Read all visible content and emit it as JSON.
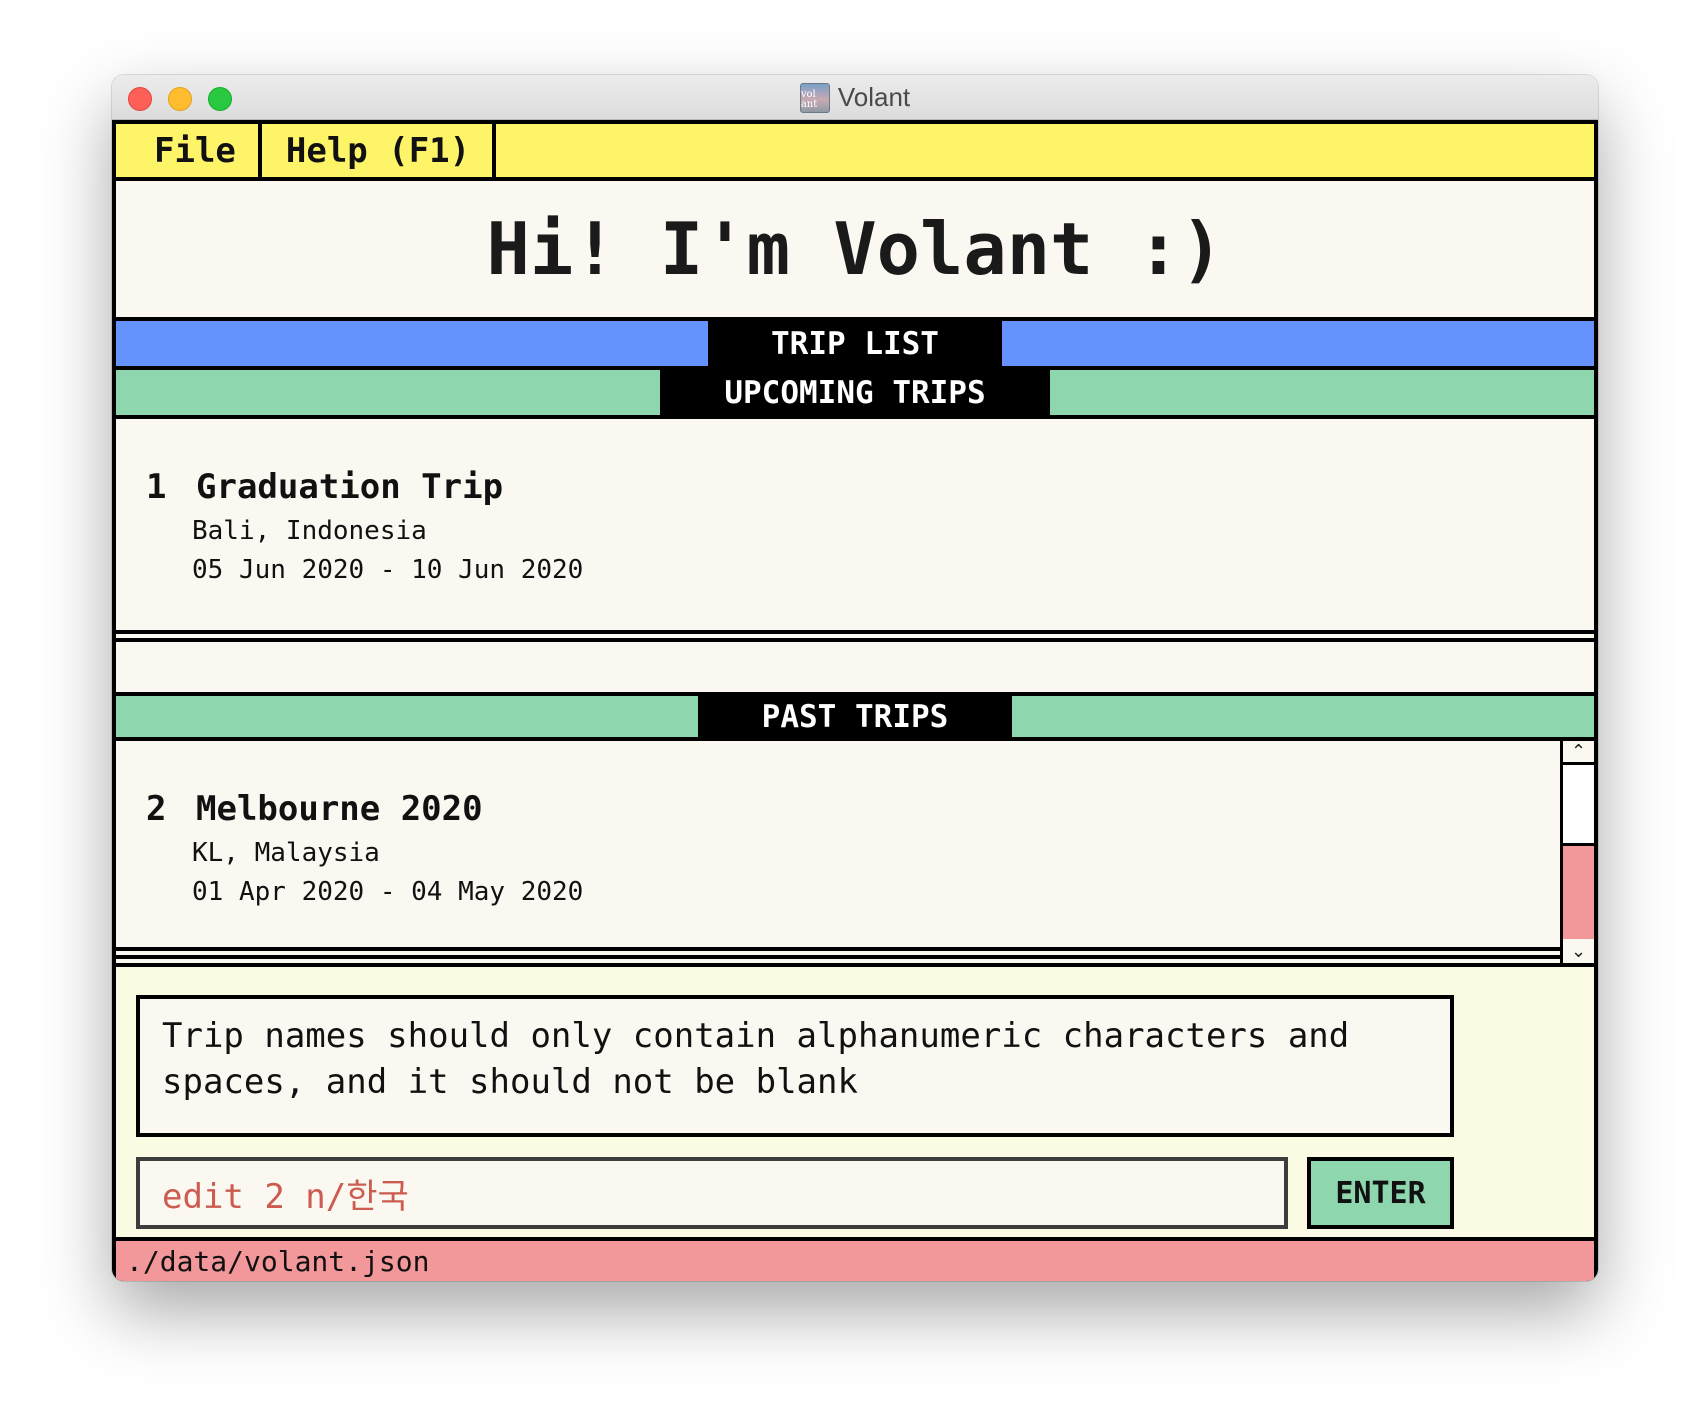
{
  "window": {
    "title": "Volant",
    "app_icon_text": "vol ant"
  },
  "menu": {
    "file_label": "File",
    "help_label": "Help (F1)"
  },
  "greeting": "Hi! I'm Volant :)",
  "sections": {
    "trip_list_label": "TRIP LIST",
    "upcoming_label": "UPCOMING TRIPS",
    "past_label": "PAST TRIPS"
  },
  "upcoming_trips": [
    {
      "index": "1",
      "name": "Graduation Trip",
      "location": "Bali, Indonesia",
      "dates": "05 Jun 2020 - 10 Jun 2020"
    }
  ],
  "past_trips": [
    {
      "index": "2",
      "name": "Melbourne 2020",
      "location": "KL, Malaysia",
      "dates": "01 Apr 2020 - 04 May 2020"
    }
  ],
  "scrollbar": {
    "thumb_start_fraction": 0.45,
    "thumb_end_fraction": 1.0,
    "up_arrow": "⌃",
    "down_arrow": "⌄"
  },
  "console": {
    "result_message": "Trip names should only contain alphanumeric characters and spaces, and it should not be blank",
    "command_value": "edit 2 n/한국",
    "enter_label": "ENTER"
  },
  "status": {
    "file_path": "./data/volant.json"
  },
  "colors": {
    "menubar": "#fef468",
    "trip_list_band": "#6692fe",
    "section_band": "#8ed6ae",
    "status_bar": "#f2979a",
    "command_text": "#cc5b50",
    "console_bg": "#fbfbe3"
  }
}
